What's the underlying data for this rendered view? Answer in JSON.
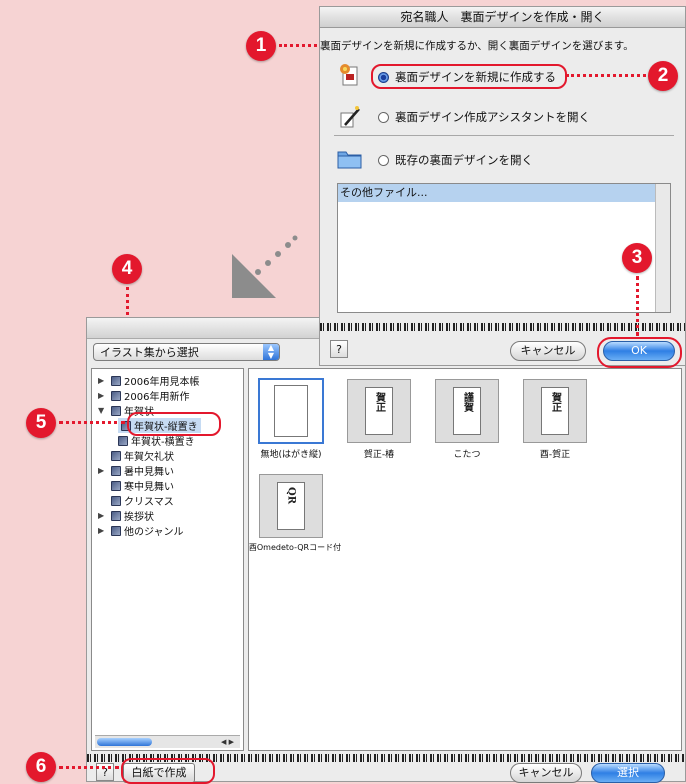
{
  "top_dialog": {
    "title": "宛名職人　裏面デザインを作成・開く",
    "instruction": "裏面デザインを新規に作成するか、開く裏面デザインを選びます。",
    "option_new": "裏面デザインを新規に作成する",
    "option_assistant": "裏面デザイン作成アシスタントを開く",
    "option_open": "既存の裏面デザインを開く",
    "file_list": [
      "その他ファイル..."
    ],
    "help": "?",
    "cancel": "キャンセル",
    "ok": "OK"
  },
  "bottom_dialog": {
    "source_popup": "イラスト集から選択",
    "tree": [
      {
        "label": "2006年用見本帳",
        "level": 0,
        "toggle": "▶"
      },
      {
        "label": "2006年用新作",
        "level": 0,
        "toggle": "▶"
      },
      {
        "label": "年賀状",
        "level": 0,
        "toggle": "▼"
      },
      {
        "label": "年賀状-縦置き",
        "level": 1,
        "toggle": "",
        "selected": true
      },
      {
        "label": "年賀状-横置き",
        "level": 1,
        "toggle": ""
      },
      {
        "label": "年賀欠礼状",
        "level": 0,
        "toggle": ""
      },
      {
        "label": "暑中見舞い",
        "level": 0,
        "toggle": "▶"
      },
      {
        "label": "寒中見舞い",
        "level": 0,
        "toggle": ""
      },
      {
        "label": "クリスマス",
        "level": 0,
        "toggle": ""
      },
      {
        "label": "挨拶状",
        "level": 0,
        "toggle": "▶"
      },
      {
        "label": "他のジャンル",
        "level": 0,
        "toggle": "▶"
      }
    ],
    "thumbnails": [
      {
        "label": "無地(はがき縦)",
        "art": "",
        "selected": true
      },
      {
        "label": "賀正-椿",
        "art": "賀正"
      },
      {
        "label": "こたつ",
        "art": "謹賀"
      },
      {
        "label": "酉-賀正",
        "art": "賀正"
      },
      {
        "label": "酉Omedeto-QRコード付",
        "art": "QR"
      }
    ],
    "help": "?",
    "blank_button": "白紙で作成",
    "cancel": "キャンセル",
    "select": "選択"
  },
  "callouts": [
    "1",
    "2",
    "3",
    "4",
    "5",
    "6"
  ],
  "colors": {
    "accent": "#e3182d",
    "background": "#f6d3d3",
    "aqua_blue": "#2f7fe4"
  }
}
